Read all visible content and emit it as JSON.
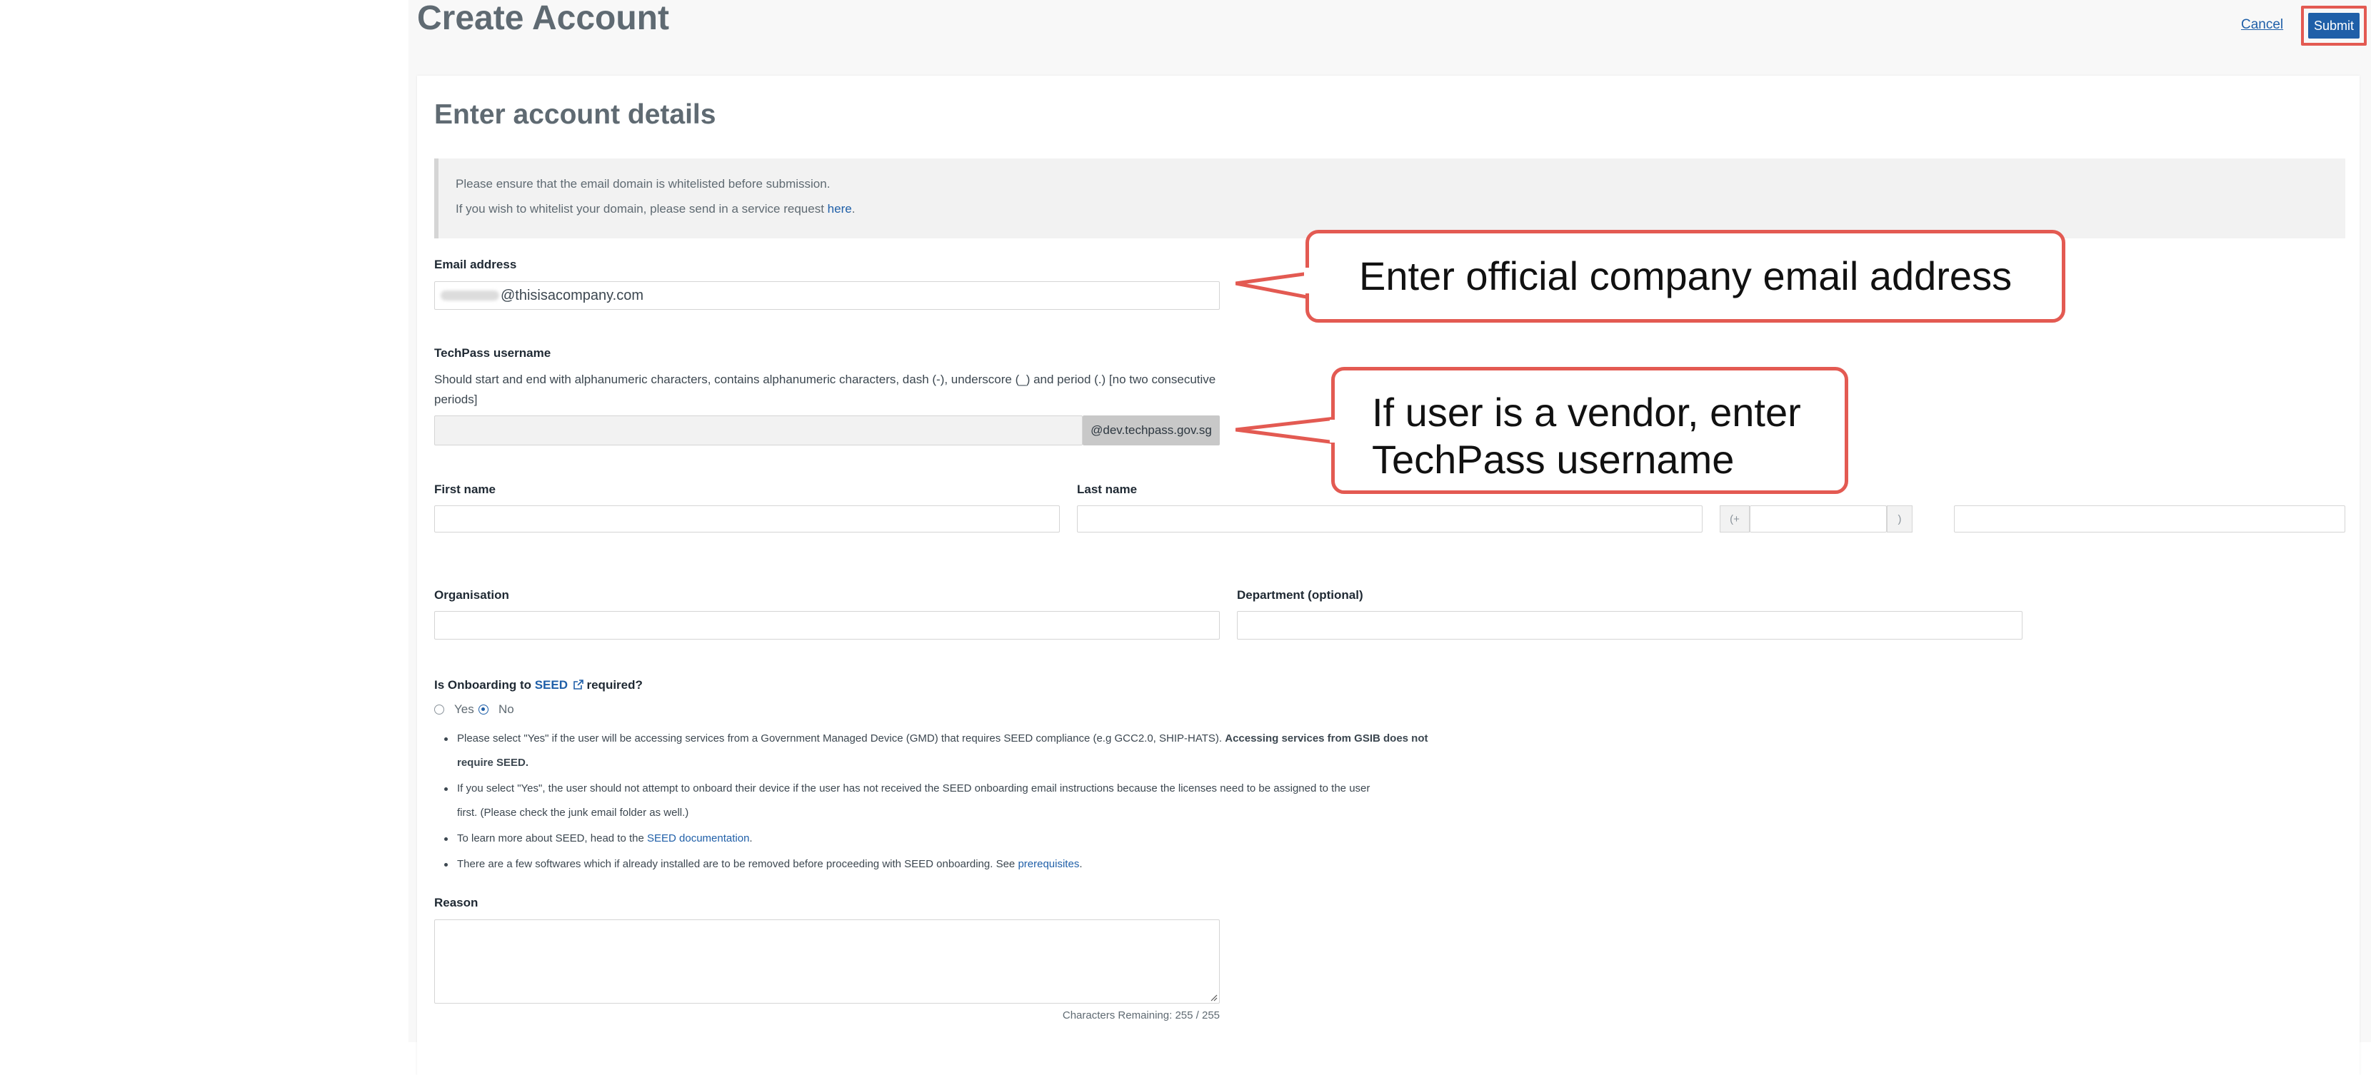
{
  "header": {
    "page_title": "Create Account",
    "cancel_label": "Cancel",
    "submit_label": "Submit"
  },
  "form": {
    "section_title": "Enter account details",
    "notice": {
      "line1": "Please ensure that the email domain is whitelisted before submission.",
      "line2_prefix": "If you wish to whitelist your domain, please send in a service request ",
      "line2_link": "here",
      "line2_suffix": "."
    },
    "email": {
      "label": "Email address",
      "value_visible": "@thisisacompany.com"
    },
    "techpass": {
      "label": "TechPass username",
      "help_line1": "Should start and end with alphanumeric characters, contains alphanumeric characters, dash (-), underscore (_) and period (.) [no two consecutive",
      "help_line2": "periods]",
      "value": "",
      "suffix": "@dev.techpass.gov.sg"
    },
    "first_name": {
      "label": "First name",
      "value": ""
    },
    "last_name": {
      "label": "Last name",
      "value": ""
    },
    "phone": {
      "prefix": "(+",
      "suffix": ")",
      "country_code": "",
      "number": ""
    },
    "organisation": {
      "label": "Organisation",
      "value": ""
    },
    "department": {
      "label": "Department (optional)",
      "value": ""
    },
    "seed": {
      "question_prefix": "Is Onboarding to ",
      "question_link": "SEED",
      "question_suffix": " required?",
      "options": [
        "Yes",
        "No"
      ],
      "selected": "No",
      "bullets": [
        {
          "text": "Please select \"Yes\" if the user will be accessing services from a Government Managed Device (GMD) that requires SEED compliance (e.g GCC2.0, SHIP-HATS). ",
          "bold": "Accessing services from GSIB does not"
        },
        {
          "text": "",
          "bold": "require SEED."
        },
        {
          "text": "If you select \"Yes\", the user should not attempt to onboard their device if the user has not received the SEED onboarding email instructions because the licenses need to be assigned to the user"
        },
        {
          "text": "first. (Please check the junk email folder as well.)"
        },
        {
          "text": "To learn more about SEED, head to the ",
          "link": "SEED documentation",
          "suffix": "."
        },
        {
          "text": "There are a few softwares which if already installed are to be removed before proceeding with SEED onboarding. See ",
          "link": "prerequisites",
          "suffix": "."
        }
      ]
    },
    "reason": {
      "label": "Reason",
      "value": "",
      "chars_remaining": "Characters Remaining: 255 / 255"
    }
  },
  "annotations": {
    "email_callout": "Enter official company email address",
    "techpass_callout_line1": "If user is a vendor, enter",
    "techpass_callout_line2": "TechPass username",
    "callout_color": "#e35a52"
  },
  "colors": {
    "accent": "#1f5fa8",
    "title_gray": "#5f6a72"
  }
}
